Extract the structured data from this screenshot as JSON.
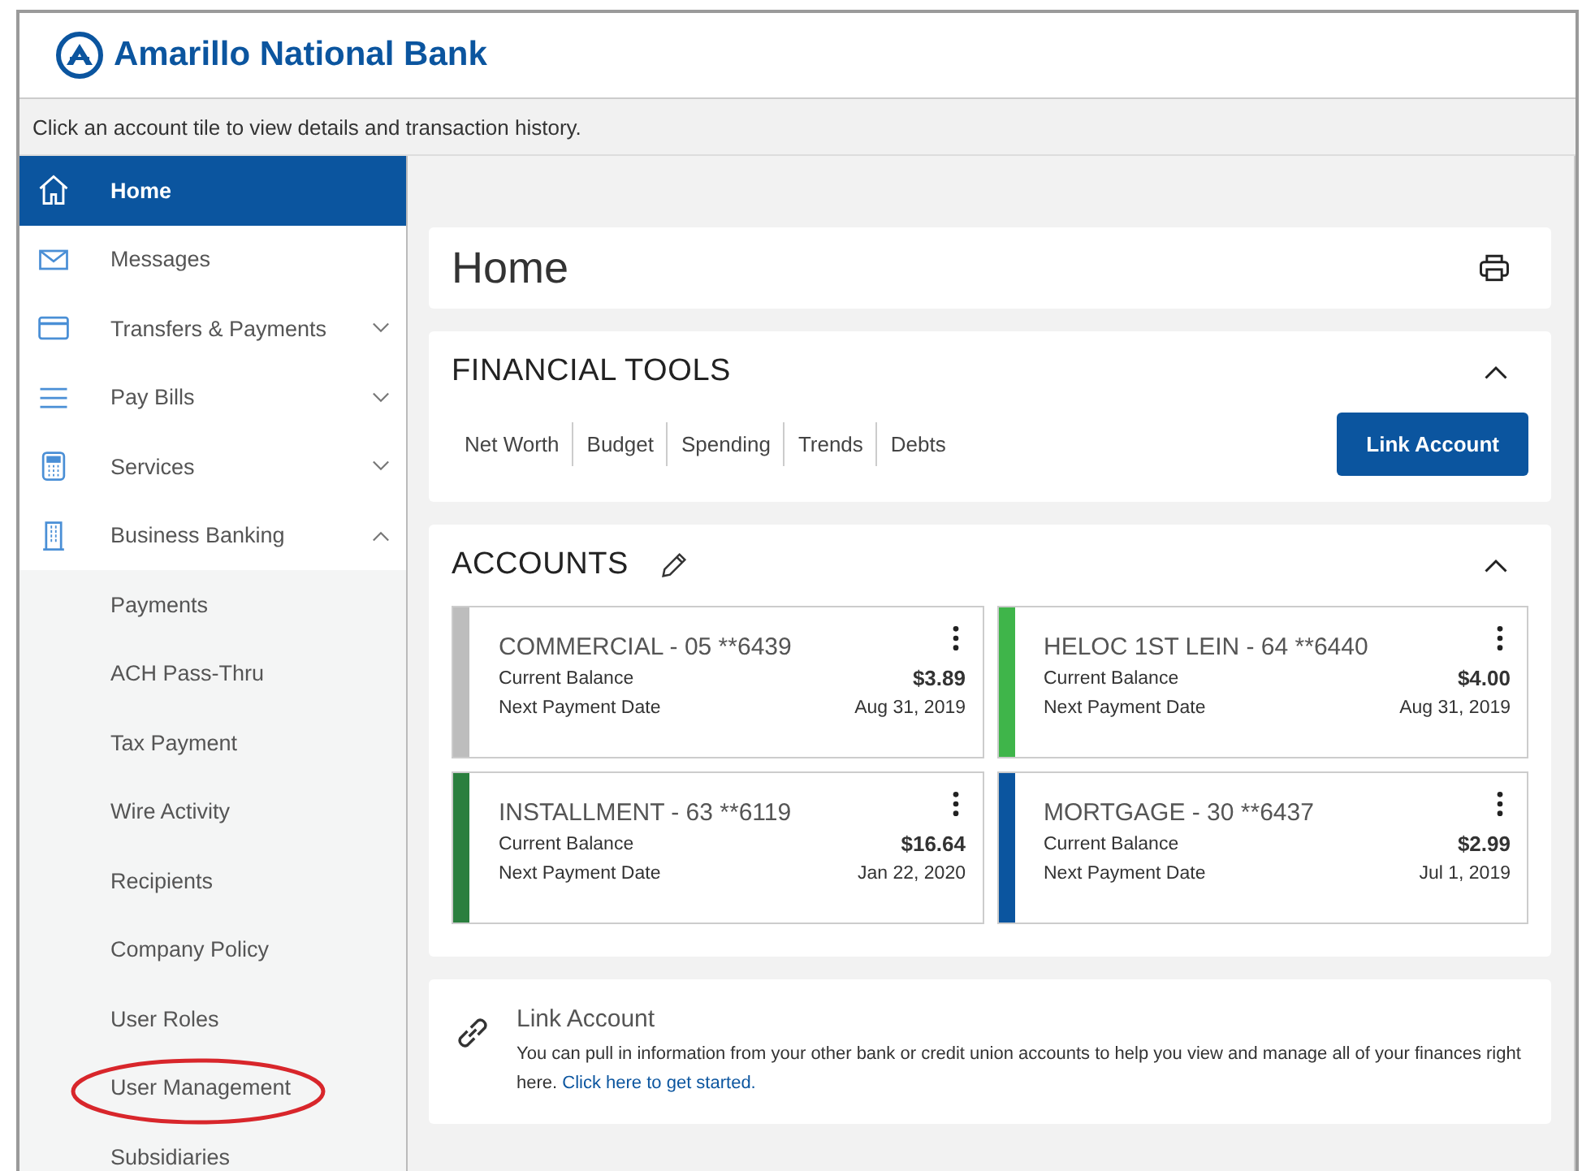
{
  "header": {
    "bank_name": "Amarillo National Bank"
  },
  "instruction": "Click an account tile to view details and transaction history.",
  "sidebar": {
    "items": [
      {
        "label": "Home",
        "kind": "home",
        "selected": true
      },
      {
        "label": "Messages",
        "kind": "messages",
        "selected": false
      },
      {
        "label": "Transfers & Payments",
        "kind": "transfers",
        "selected": false,
        "expanded": false
      },
      {
        "label": "Pay Bills",
        "kind": "bills",
        "selected": false,
        "expanded": false
      },
      {
        "label": "Services",
        "kind": "services",
        "selected": false,
        "expanded": false
      },
      {
        "label": "Business Banking",
        "kind": "business",
        "selected": false,
        "expanded": true,
        "children": [
          {
            "label": "Payments",
            "highlighted": false
          },
          {
            "label": "ACH Pass-Thru",
            "highlighted": false
          },
          {
            "label": "Tax Payment",
            "highlighted": false
          },
          {
            "label": "Wire Activity",
            "highlighted": false
          },
          {
            "label": "Recipients",
            "highlighted": false
          },
          {
            "label": "Company Policy",
            "highlighted": false
          },
          {
            "label": "User Roles",
            "highlighted": false
          },
          {
            "label": "User Management",
            "highlighted": true
          },
          {
            "label": "Subsidiaries",
            "highlighted": false
          }
        ]
      }
    ]
  },
  "page_title": "Home",
  "financial_tools": {
    "title": "FINANCIAL TOOLS",
    "expanded": true,
    "links": [
      "Net Worth",
      "Budget",
      "Spending",
      "Trends",
      "Debts"
    ],
    "button": "Link Account"
  },
  "accounts": {
    "title": "ACCOUNTS",
    "expanded": true,
    "tiles": [
      {
        "name": "COMMERCIAL - 05 **6439",
        "color": "#bdbdbd",
        "balance_label": "Current Balance",
        "balance": "$3.89",
        "date_label": "Next Payment Date",
        "date": "Aug 31, 2019"
      },
      {
        "name": "HELOC 1ST LEIN - 64 **6440",
        "color": "#3fb54a",
        "balance_label": "Current Balance",
        "balance": "$4.00",
        "date_label": "Next Payment Date",
        "date": "Aug 31, 2019"
      },
      {
        "name": "INSTALLMENT - 63 **6119",
        "color": "#2a7f3e",
        "balance_label": "Current Balance",
        "balance": "$16.64",
        "date_label": "Next Payment Date",
        "date": "Jan 22, 2020"
      },
      {
        "name": "MORTGAGE - 30 **6437",
        "color": "#0b559f",
        "balance_label": "Current Balance",
        "balance": "$2.99",
        "date_label": "Next Payment Date",
        "date": "Jul 1, 2019"
      }
    ]
  },
  "link_account": {
    "title": "Link Account",
    "text": "You can pull in information from your other bank or credit union accounts to help you view and manage all of your finances right here.",
    "link": "Click here to get started."
  }
}
